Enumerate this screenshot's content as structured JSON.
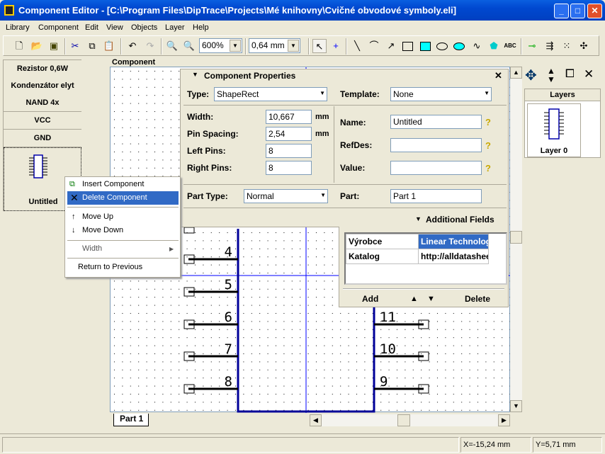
{
  "window": {
    "title": "Component Editor - [C:\\Program Files\\DipTrace\\Projects\\Mé knihovny\\Cvičné obvodové symboly.eli]",
    "minimize": "_",
    "maximize": "□",
    "close": "✕"
  },
  "menu": [
    "Library",
    "Component",
    "Edit",
    "View",
    "Objects",
    "Layer",
    "Help"
  ],
  "toolbar": {
    "zoom": "600%",
    "line_width": "0,64 mm",
    "icons": [
      "new-icon",
      "open-icon",
      "save-icon",
      "cut-icon",
      "copy-icon",
      "paste-icon",
      "undo-icon",
      "redo-icon",
      "zoom-in-icon",
      "zoom-out-icon",
      "select-icon",
      "crosshair-icon",
      "line-icon",
      "arc-icon",
      "arrow-icon",
      "rectangle-icon",
      "filled-rectangle-icon",
      "ellipse-icon",
      "filled-ellipse-icon",
      "polyline-icon",
      "polygon-icon",
      "text-icon",
      "place-pin-icon",
      "pin-matrix-icon",
      "pin-array-icon",
      "pin-group-icon"
    ],
    "text_tool": "ABC"
  },
  "components": [
    "Rezistor 0,6W",
    "Kondenzátor elyt",
    "NAND 4x",
    "VCC",
    "GND",
    "Untitled"
  ],
  "context_menu": {
    "items": [
      "Insert Component",
      "Delete Component",
      "Move Up",
      "Move Down",
      "Width",
      "Return to Previous"
    ],
    "highlighted": "Delete Component"
  },
  "canvas": {
    "label": "Component",
    "tab": "Part 1",
    "left_pins": [
      "4",
      "5",
      "6",
      "7",
      "8"
    ],
    "right_pins": [
      "11",
      "10",
      "9"
    ],
    "body_color": "#000099",
    "cursor_color": "#0000ff"
  },
  "properties": {
    "title": "Component Properties",
    "close": "✕",
    "type_label": "Type:",
    "type": "ShapeRect",
    "template_label": "Template:",
    "template": "None",
    "width_label": "Width:",
    "width": "10,667",
    "width_unit": "mm",
    "pin_spacing_label": "Pin Spacing:",
    "pin_spacing": "2,54",
    "pin_spacing_unit": "mm",
    "left_pins_label": "Left Pins:",
    "left_pins": "8",
    "right_pins_label": "Right Pins:",
    "right_pins": "8",
    "name_label": "Name:",
    "name": "Untitled",
    "refdes_label": "RefDes:",
    "refdes": "",
    "value_label": "Value:",
    "value": "",
    "part_type_label": "Part Type:",
    "part_type": "Normal",
    "part_label": "Part:",
    "part": "Part 1",
    "additional_fields": "Additional Fields",
    "help": "?"
  },
  "additional_fields": {
    "rows": [
      [
        "Výrobce",
        "Linear Technology"
      ],
      [
        "Katalog",
        "http://alldatasheet"
      ]
    ],
    "add": "Add",
    "delete": "Delete",
    "up": "▲",
    "down": "▼"
  },
  "layers": {
    "title": "Layers",
    "items": [
      "Layer 0"
    ]
  },
  "status": {
    "x": "X=-15,24 mm",
    "y": "Y=5,71 mm"
  }
}
